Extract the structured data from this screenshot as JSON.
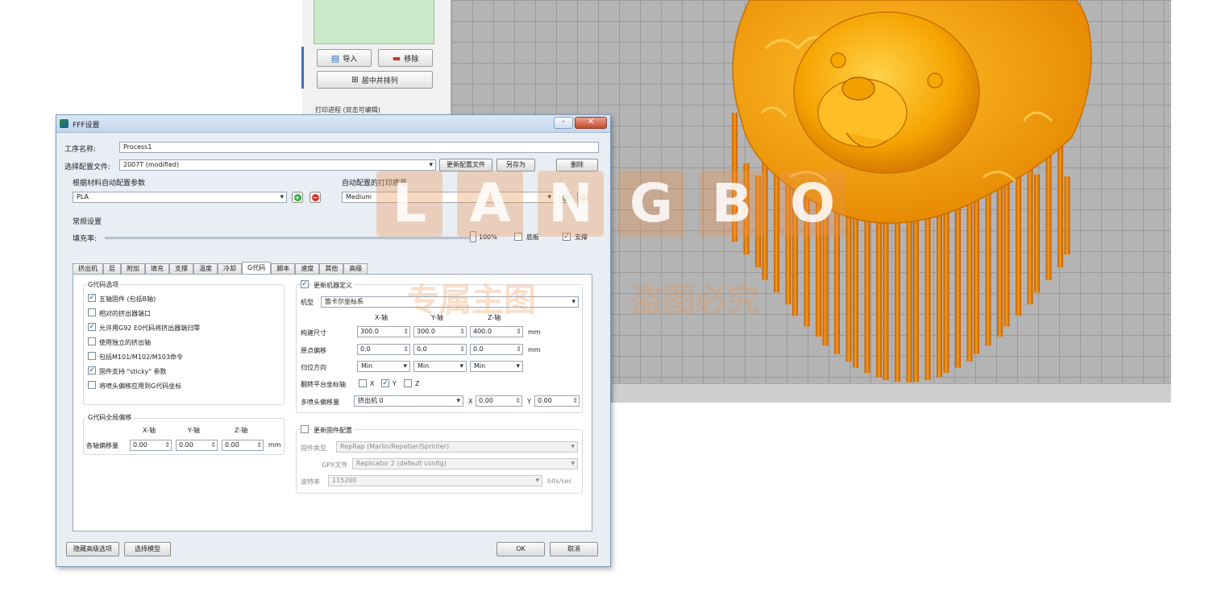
{
  "side_panel": {
    "import_label": "导入",
    "delete_label": "移除",
    "center_label": "居中并排列",
    "print_progress": "打印进程 (双击可编辑)"
  },
  "dialog": {
    "title": "FFF设置",
    "min_glyph": "-",
    "close_glyph": "✕",
    "process_name_label": "工序名称:",
    "process_name_value": "Process1",
    "profile_label": "选择配置文件:",
    "profile_value": "2007T (modified)",
    "update_profile_label": "更新配置文件",
    "save_as_label": "另存为",
    "remove_label": "删除",
    "material_label": "根据材料自动配置参数",
    "material_value": "PLA",
    "quality_label": "自动配置的打印质量",
    "quality_value": "Medium",
    "add_glyph": "+",
    "remove_glyph": "−",
    "general_label": "常规设置",
    "infill_label": "填充率:",
    "infill_value": "100%",
    "raft_label": "底板",
    "support_label": "支撑",
    "tabs": [
      "挤出机",
      "层",
      "附加",
      "填充",
      "支撑",
      "温度",
      "冷却",
      "G代码",
      "脚本",
      "速度",
      "其他",
      "高级"
    ],
    "active_tab": 7,
    "gcode_options": {
      "title": "G代码选项",
      "items": [
        {
          "label": "五轴固件 (包括B轴)",
          "checked": true
        },
        {
          "label": "相对的挤出器端口",
          "checked": false
        },
        {
          "label": "允许用G92 E0代码将挤出器端归零",
          "checked": true
        },
        {
          "label": "使用独立的挤出轴",
          "checked": false
        },
        {
          "label": "包括M101/M102/M103命令",
          "checked": false
        },
        {
          "label": "固件支持 \"sticky\" 参数",
          "checked": true
        },
        {
          "label": "将喷头偏移应用到G代码坐标",
          "checked": false
        }
      ]
    },
    "gcode_offset": {
      "title": "G代码全局偏移",
      "axes": [
        "X-轴",
        "Y-轴",
        "Z-轴"
      ],
      "row_label": "各轴偏移量",
      "values": [
        "0.00",
        "0.00",
        "0.00"
      ],
      "unit": "mm"
    },
    "machine": {
      "override_label": "更新机器定义",
      "override_checked": true,
      "type_label": "机型",
      "type_value": "笛卡尔坐标系",
      "axes": [
        "X-轴",
        "Y-轴",
        "Z-轴"
      ],
      "build_label": "构建尺寸",
      "build_values": [
        "300.0",
        "300.0",
        "400.0"
      ],
      "origin_label": "原点偏移",
      "origin_values": [
        "0.0",
        "0.0",
        "0.0"
      ],
      "home_label": "归位方向",
      "home_values": [
        "Min",
        "Min",
        "Min"
      ],
      "unit": "mm",
      "flip_label": "翻转平台坐标轴",
      "flip_axes": [
        {
          "label": "X",
          "checked": false
        },
        {
          "label": "Y",
          "checked": true
        },
        {
          "label": "Z",
          "checked": false
        }
      ],
      "nozzle_offset_label": "多喷头偏移量",
      "nozzle_value": "挤出机 0",
      "offset_x_label": "X",
      "offset_x_value": "0.00",
      "offset_y_label": "Y",
      "offset_y_value": "0.00"
    },
    "firmware": {
      "override_label": "更新固件配置",
      "override_checked": false,
      "type_label": "固件类型",
      "type_value": "RepRap (Marlin/Repetier/Sprinter)",
      "gpx_label": "GPX文件",
      "gpx_value": "Replicator 2 (default config)",
      "baud_label": "波特率",
      "baud_value": "115200",
      "baud_unit": "bits/sec"
    },
    "hide_advanced_label": "隐藏高级选项",
    "select_model_label": "选择模型",
    "ok_label": "OK",
    "cancel_label": "取消"
  },
  "watermark": {
    "letters": [
      "L",
      "A",
      "N",
      "G",
      "B",
      "O"
    ],
    "text_left": "专属主图",
    "text_right": "盗图必究"
  },
  "colors": {
    "model": "#f2a000",
    "viewport": "#b4b4b4",
    "watermark": "#ec9650"
  }
}
